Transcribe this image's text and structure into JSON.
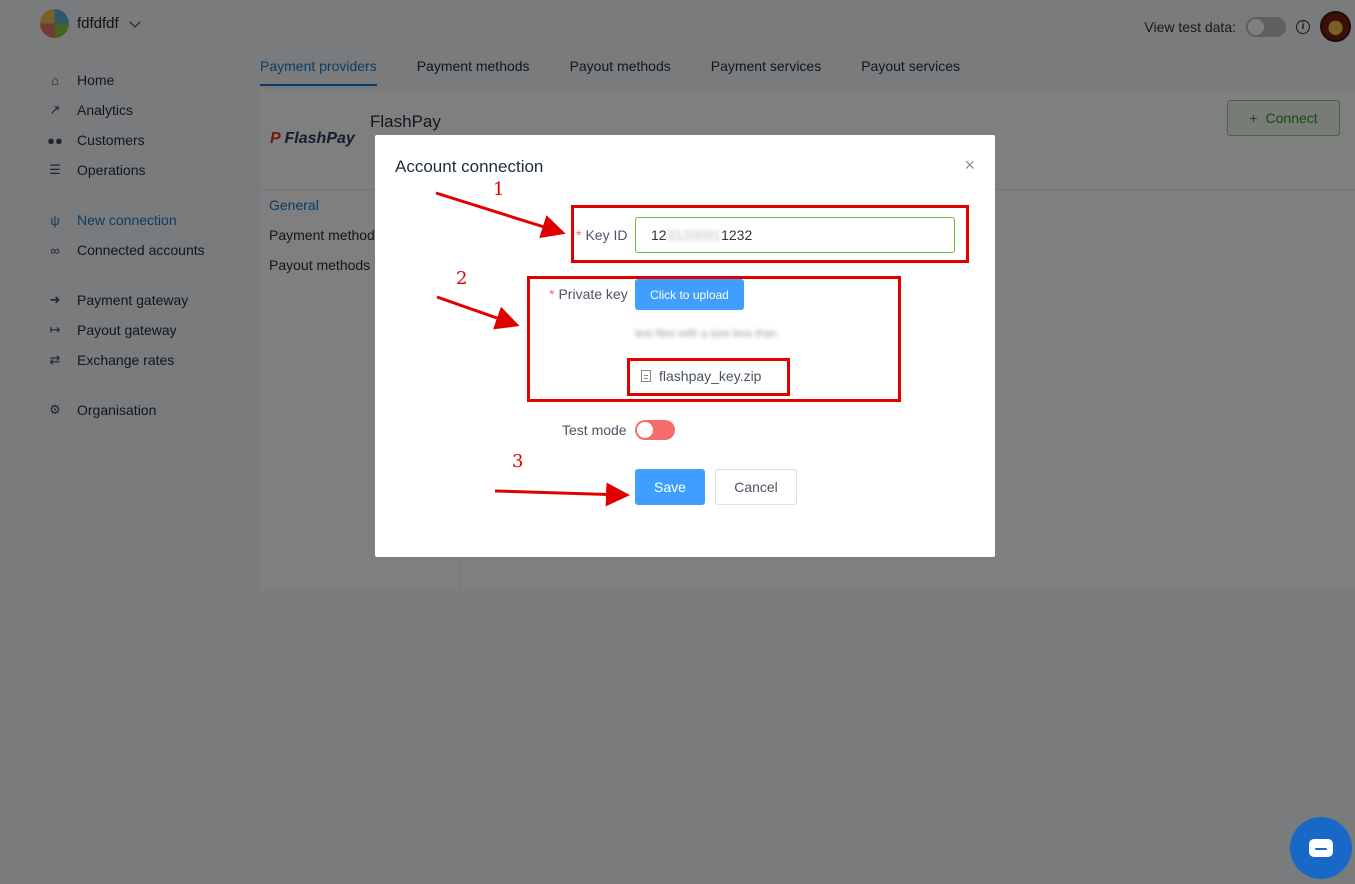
{
  "header": {
    "org_name": "fdfdfdf",
    "test_data_label": "View test data:",
    "info_icon": "i"
  },
  "sidebar": {
    "items": [
      {
        "label": "Home",
        "icon": "home-icon",
        "glyph": "⌂"
      },
      {
        "label": "Analytics",
        "icon": "chart-icon",
        "glyph": "📈"
      },
      {
        "label": "Customers",
        "icon": "users-icon",
        "glyph": "👥"
      },
      {
        "label": "Operations",
        "icon": "list-icon",
        "glyph": "☰"
      },
      {
        "label": "New connection",
        "icon": "plug-icon",
        "glyph": "🔌"
      },
      {
        "label": "Connected accounts",
        "icon": "link-icon",
        "glyph": "🔗"
      },
      {
        "label": "Payment gateway",
        "icon": "sign-in-icon",
        "glyph": "➜"
      },
      {
        "label": "Payout gateway",
        "icon": "sign-out-icon",
        "glyph": "↦"
      },
      {
        "label": "Exchange rates",
        "icon": "exchange-icon",
        "glyph": "⇄"
      },
      {
        "label": "Organisation",
        "icon": "gear-icon",
        "glyph": "⚙"
      }
    ]
  },
  "tabs": [
    "Payment providers",
    "Payment methods",
    "Payout methods",
    "Payment services",
    "Payout services"
  ],
  "provider": {
    "logo_text_p": "P",
    "logo_text": "FlashPay",
    "title": "FlashPay",
    "connect_label": "Connect",
    "connect_plus": "+",
    "side_menu": [
      "General",
      "Payment methods",
      "Payout methods"
    ]
  },
  "modal": {
    "title": "Account connection",
    "close": "×",
    "key_id_label": "Key ID",
    "key_id_value_start": "12",
    "key_id_value_hidden": "3120091",
    "key_id_value_end": "1232",
    "private_key_label": "Private key",
    "upload_label": "Click to upload",
    "upload_hint": "text files with a size less than",
    "file_name": "flashpay_key.zip",
    "test_mode_label": "Test mode",
    "save_label": "Save",
    "cancel_label": "Cancel",
    "required_mark": "*"
  },
  "annotations": {
    "step1": "1",
    "step2": "2",
    "step3": "3",
    "color": "#e00000"
  }
}
